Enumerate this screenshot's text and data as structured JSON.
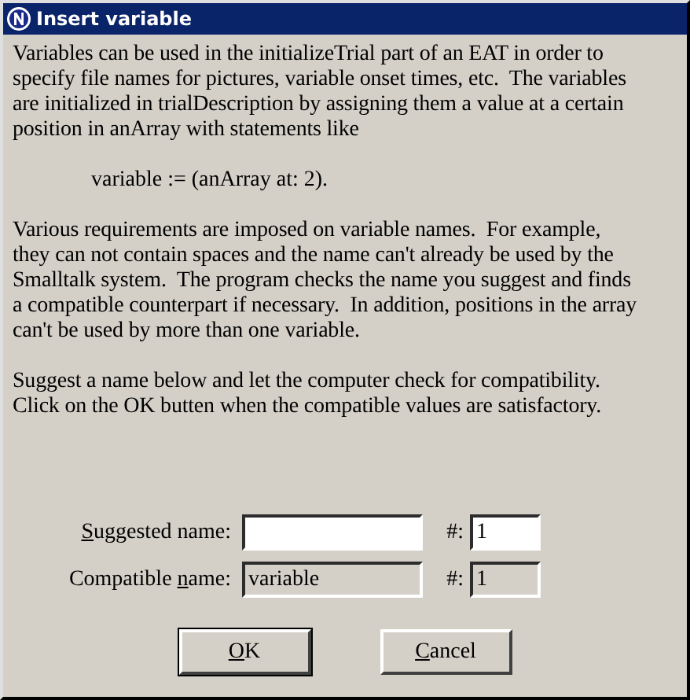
{
  "window": {
    "title": "Insert variable"
  },
  "paragraphs": [
    {
      "kind": "text",
      "text": "Variables can be used in the initializeTrial part of an EAT in order to\nspecify file names for pictures, variable onset times, etc.  The variables\nare initialized in trialDescription by assigning them a value at a certain\nposition in anArray with statements like"
    },
    {
      "kind": "code",
      "text": "variable := (anArray at: 2)."
    },
    {
      "kind": "text",
      "text": "Various requirements are imposed on variable names.  For example,\nthey can not contain spaces and the name can't already be used by the\nSmalltalk system.  The program checks the name you suggest and finds\na compatible counterpart if necessary.  In addition, positions in the array\ncan't be used by more than one variable."
    },
    {
      "kind": "text",
      "text": "Suggest a name below and let the computer check for compatibility.\nClick on the OK butten when the compatible values are satisfactory."
    }
  ],
  "fields": [
    {
      "label_parts": [
        {
          "text": "S",
          "underline": true
        },
        {
          "text": "uggested name:",
          "underline": false
        }
      ],
      "disabled": false,
      "hash": "#:",
      "number": "1"
    },
    {
      "label_parts": [
        {
          "text": "Compatible ",
          "underline": false
        },
        {
          "text": "n",
          "underline": true
        },
        {
          "text": "ame:",
          "underline": false
        }
      ],
      "value": "variable",
      "disabled": true,
      "hash": "#:",
      "number": "1"
    }
  ],
  "buttons": [
    {
      "parts": [
        {
          "text": "O",
          "underline": true
        },
        {
          "text": "K",
          "underline": false
        }
      ],
      "default": true
    },
    {
      "parts": [
        {
          "text": "C",
          "underline": true
        },
        {
          "text": "ancel",
          "underline": false
        }
      ],
      "default": false
    }
  ]
}
